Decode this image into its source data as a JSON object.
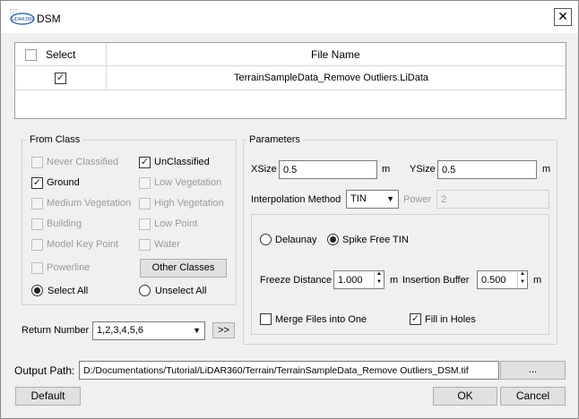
{
  "window": {
    "title": "DSM",
    "logo_text": "LiDAR360",
    "close_glyph": "✕"
  },
  "file_table": {
    "headers": {
      "select": "Select",
      "file_name": "File Name"
    },
    "rows": [
      {
        "checked": "✓",
        "file_name": "TerrainSampleData_Remove Outliers.LiData"
      }
    ]
  },
  "from_class": {
    "title": "From Class",
    "classes": {
      "never_classified": "Never Classified",
      "unclassified": "UnClassified",
      "ground": "Ground",
      "low_vegetation": "Low Vegetation",
      "medium_vegetation": "Medium Vegetation",
      "high_vegetation": "High Vegetation",
      "building": "Building",
      "low_point": "Low Point",
      "model_key_point": "Model Key Point",
      "water": "Water",
      "powerline": "Powerline"
    },
    "checked_glyph": "✓",
    "other_classes": "Other Classes",
    "select_all": "Select All",
    "unselect_all": "Unselect All"
  },
  "return_number": {
    "label": "Return Number",
    "value": "1,2,3,4,5,6",
    "more": ">>"
  },
  "parameters": {
    "title": "Parameters",
    "xsize_label": "XSize",
    "xsize_value": "0.5",
    "ysize_label": "YSize",
    "ysize_value": "0.5",
    "unit": "m",
    "interp_label": "Interpolation Method",
    "interp_value": "TIN",
    "power_label": "Power",
    "power_value": "2",
    "delaunay": "Delaunay",
    "spike_free": "Spike Free TIN",
    "freeze_label": "Freeze Distance",
    "freeze_value": "1.000",
    "insertion_label": "Insertion Buffer",
    "insertion_value": "0.500",
    "merge_label": "Merge Files into One",
    "fill_label": "Fill in Holes"
  },
  "output": {
    "label": "Output Path:",
    "value": "D:/Documentations/Tutorial/LiDAR360/Terrain/TerrainSampleData_Remove Outliers_DSM.tif",
    "browse": "..."
  },
  "buttons": {
    "default": "Default",
    "ok": "OK",
    "cancel": "Cancel"
  },
  "colors": {
    "background": "#f0f0f0",
    "table_bg": "#ffffff",
    "border": "#adadad"
  }
}
